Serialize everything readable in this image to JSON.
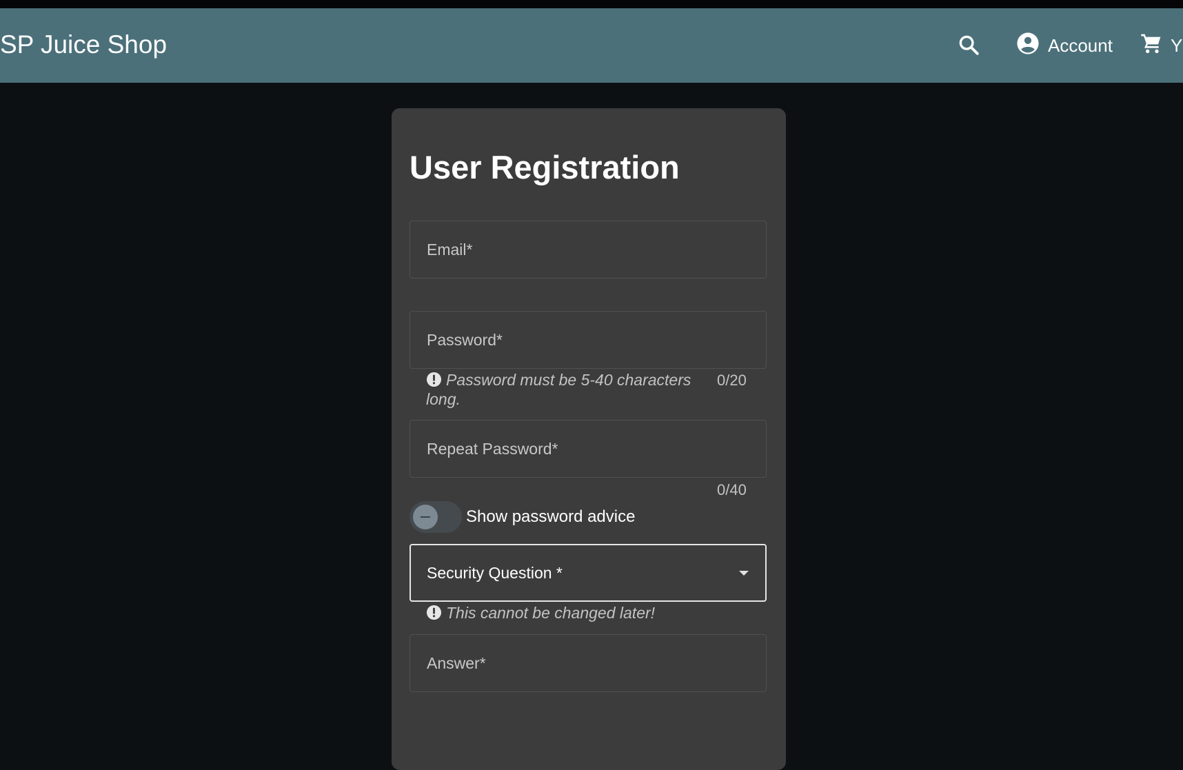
{
  "header": {
    "app_title": "SP Juice Shop",
    "search_icon": "search-icon",
    "account_label": "Account",
    "account_icon": "account-circle-icon",
    "cart_label": "Y",
    "cart_icon": "shopping-cart-icon",
    "bar_color": "#4b7079"
  },
  "form": {
    "title": "User Registration",
    "email": {
      "label": "Email*"
    },
    "password": {
      "label": "Password*",
      "hint": "Password must be 5-40 characters long.",
      "counter": "0/20"
    },
    "repeat_password": {
      "label": "Repeat Password*",
      "counter": "0/40"
    },
    "password_advice_toggle": {
      "label": "Show password advice",
      "checked": false
    },
    "security_question": {
      "label": "Security Question *",
      "hint": "This cannot be changed later!"
    },
    "answer": {
      "label": "Answer*"
    }
  }
}
